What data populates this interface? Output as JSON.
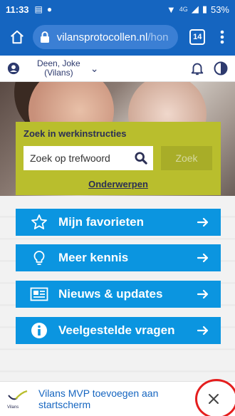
{
  "status_bar": {
    "time": "11:33",
    "signal_label": "4G",
    "battery": "53%"
  },
  "browser": {
    "url_host": "vilansprotocollen.nl",
    "url_path": "/hon",
    "tab_count": "14"
  },
  "header": {
    "user_name_line1": "Deen, Joke",
    "user_name_line2": "(Vilans)"
  },
  "search": {
    "title": "Zoek in werkinstructies",
    "placeholder": "Zoek op trefwoord",
    "button_label": "Zoek",
    "topics_link": "Onderwerpen"
  },
  "nav": [
    {
      "label": "Mijn favorieten",
      "icon": "star-icon"
    },
    {
      "label": "Meer kennis",
      "icon": "lightbulb-icon"
    },
    {
      "label": "Nieuws & updates",
      "icon": "newspaper-icon"
    },
    {
      "label": "Veelgestelde vragen",
      "icon": "info-icon"
    }
  ],
  "install_banner": {
    "text_line1": "Vilans MVP toevoegen aan",
    "text_line2": "startscherm",
    "logo_text": "Vilans"
  },
  "colors": {
    "browser_blue": "#1565c0",
    "card_olive": "#b9be2d",
    "nav_blue": "#0b95e0",
    "highlight_red": "#e41e1e"
  }
}
